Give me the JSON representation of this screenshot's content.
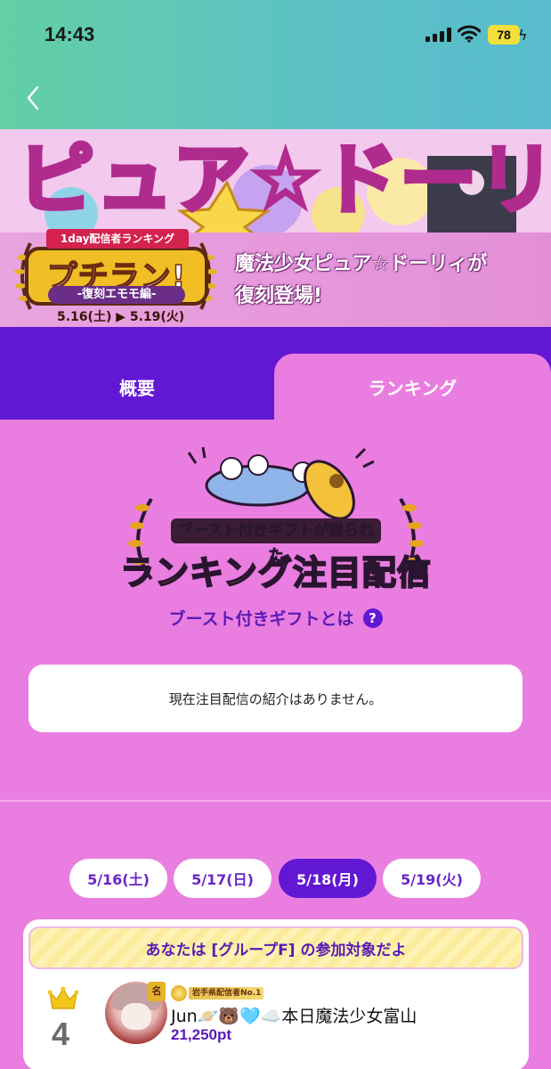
{
  "status_bar": {
    "time": "14:43",
    "battery": "78"
  },
  "header": {
    "back_icon": "chevron-left-icon"
  },
  "banner": {
    "title_art": "ピュア☆ドーリィ",
    "badge_top": "1day配信者ランキング",
    "badge_title": "プチラン!",
    "badge_sub": "-復刻エモモ編-",
    "badge_dates": "5.16(土) ▶ 5.19(火)",
    "caption_line1": "魔法少女ピュア☆ドーリィが",
    "caption_line2": "復刻登場!"
  },
  "tabs": [
    {
      "label": "概要",
      "active": false
    },
    {
      "label": "ランキング",
      "active": true
    }
  ],
  "boost": {
    "graphic_small": "ブースト付きギフトが贈られた",
    "graphic_big": "ランキング注目配信",
    "link_text": "ブースト付きギフトとは",
    "help_icon": "?"
  },
  "notice": {
    "text": "現在注目配信の紹介はありません。"
  },
  "dates": [
    {
      "label": "5/16(土)",
      "active": false
    },
    {
      "label": "5/17(日)",
      "active": false
    },
    {
      "label": "5/18(月)",
      "active": true
    },
    {
      "label": "5/19(火)",
      "active": false
    }
  ],
  "ranking": {
    "group_notice": "あなたは [グループF] の参加対象だよ",
    "entries": [
      {
        "rank": "4",
        "avatar_tag": "名",
        "title_badge": "岩手県配信者No.1",
        "name": "Jun🪐🐻🩵☁️本日魔法少女富山",
        "points": "21,250pt"
      }
    ]
  },
  "colors": {
    "header_gradient_start": "#63cfa5",
    "header_gradient_end": "#58bccd",
    "tab_bar": "#6217d4",
    "page_bg": "#ea7ee0",
    "accent_purple": "#5a1bb5"
  }
}
